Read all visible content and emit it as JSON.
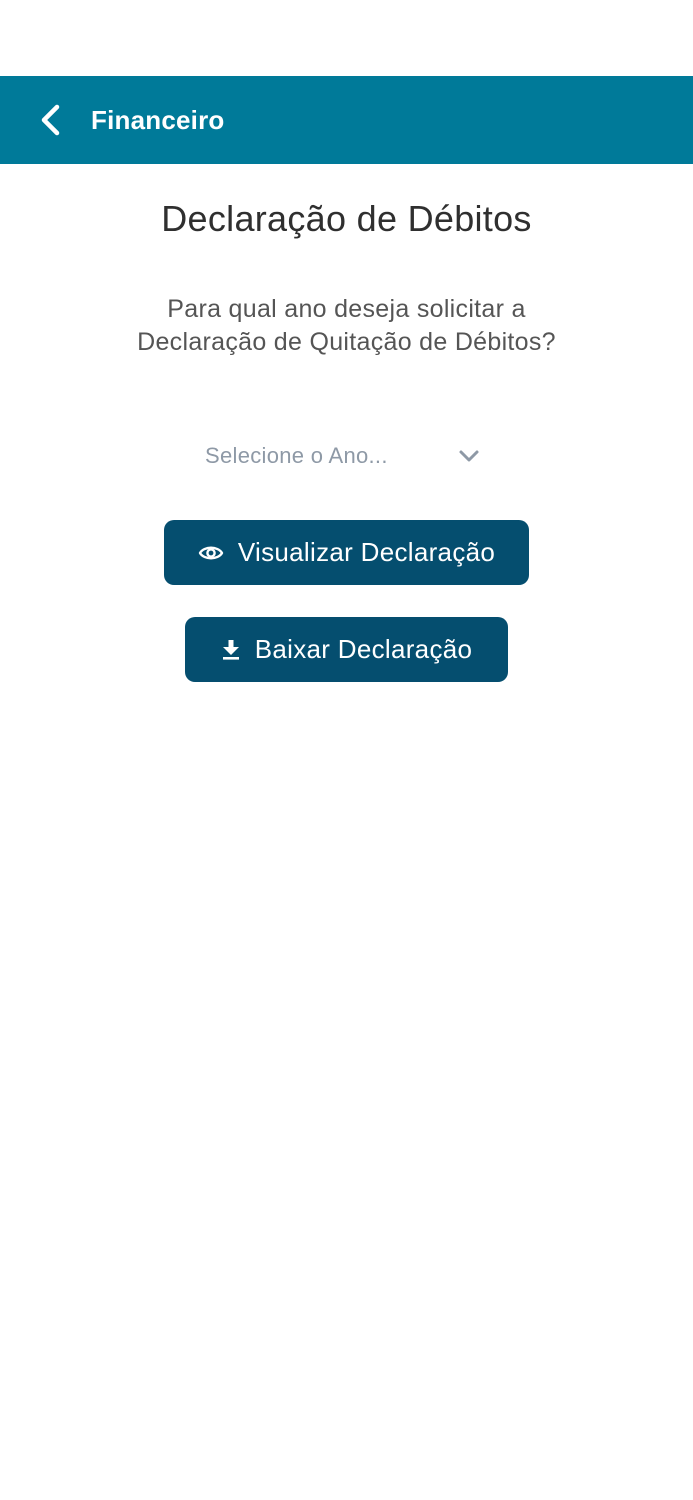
{
  "header": {
    "back_icon": "chevron-left-icon",
    "title": "Financeiro",
    "background_color": "#007a99"
  },
  "main": {
    "title": "Declaração de Débitos",
    "question": "Para qual ano deseja solicitar a Declaração de Quitação de Débitos?",
    "year_select": {
      "placeholder": "Selecione o Ano...",
      "icon": "chevron-down-icon"
    },
    "buttons": {
      "view": {
        "label": "Visualizar Declaração",
        "icon": "eye-icon"
      },
      "download": {
        "label": "Baixar Declaração",
        "icon": "download-icon"
      }
    },
    "button_color": "#054e6f"
  }
}
